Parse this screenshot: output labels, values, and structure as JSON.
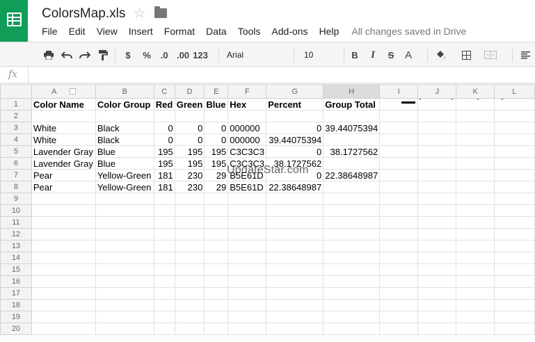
{
  "app": {
    "doc_title": "ColorsMap.xls",
    "menu": [
      "File",
      "Edit",
      "View",
      "Insert",
      "Format",
      "Data",
      "Tools",
      "Add-ons",
      "Help"
    ],
    "save_status": "All changes saved in Drive"
  },
  "toolbar": {
    "currency": "$",
    "percent": "%",
    "decrease_decimal": ".0",
    "increase_decimal": ".00",
    "more_formats": "123",
    "font": "Arial",
    "font_size": "10",
    "bold": "B",
    "italic": "I",
    "strikethrough": "S",
    "text_color_letter": "A",
    "text_color": "#000000",
    "accent_color": "#0f9d58"
  },
  "formula_bar": {
    "fx": "fx",
    "value": ""
  },
  "grid": {
    "columns": [
      "A",
      "B",
      "C",
      "D",
      "E",
      "F",
      "G",
      "H",
      "I",
      "J",
      "K",
      "L"
    ],
    "selected_column": "H",
    "row_numbers": [
      "1",
      "2",
      "3",
      "4",
      "5",
      "6",
      "7",
      "8",
      "9",
      "10",
      "11",
      "12",
      "13",
      "14",
      "15",
      "16",
      "17",
      "18",
      "19",
      "20"
    ],
    "header_row": [
      "Color Name",
      "Color Group",
      "Red",
      "Green",
      "Blue",
      "Hex",
      "Percent",
      "Group Total"
    ],
    "rows": [
      [
        "White",
        "Black",
        "0",
        "0",
        "0",
        "000000",
        "0",
        "39.44075394"
      ],
      [
        "White",
        "Black",
        "0",
        "0",
        "0",
        "000000",
        "39.44075394",
        ""
      ],
      [
        "Lavender Gray",
        "Blue",
        "195",
        "195",
        "195",
        "C3C3C3",
        "0",
        "38.1727562"
      ],
      [
        "Lavender Gray",
        "Blue",
        "195",
        "195",
        "195",
        "C3C3C3",
        "38.1727562",
        ""
      ],
      [
        "Pear",
        "Yellow-Green",
        "181",
        "230",
        "29",
        "B5E61D",
        "0",
        "22.38648987"
      ],
      [
        "Pear",
        "Yellow-Green",
        "181",
        "230",
        "29",
        "B5E61D",
        "22.38648987",
        ""
      ]
    ]
  },
  "watermark": "UpdateStar.com"
}
